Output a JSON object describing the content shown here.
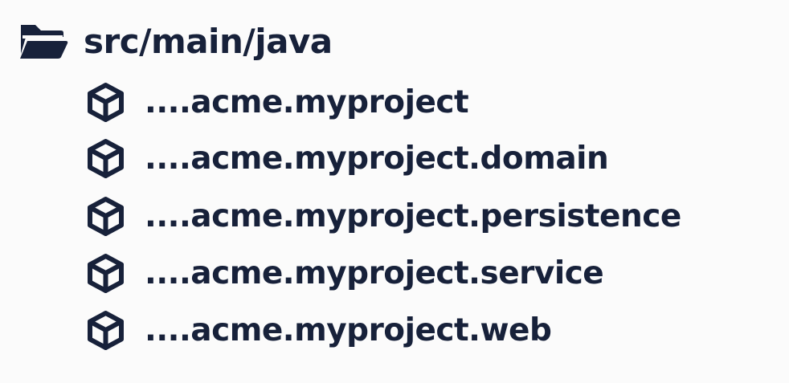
{
  "root": {
    "label": "src/main/java",
    "icon": "folder-open-icon"
  },
  "packages": [
    {
      "label": "....acme.myproject",
      "icon": "package-icon"
    },
    {
      "label": "....acme.myproject.domain",
      "icon": "package-icon"
    },
    {
      "label": "....acme.myproject.persistence",
      "icon": "package-icon"
    },
    {
      "label": "....acme.myproject.service",
      "icon": "package-icon"
    },
    {
      "label": "....acme.myproject.web",
      "icon": "package-icon"
    }
  ],
  "colors": {
    "background": "#fbfbfb",
    "foreground": "#17213a"
  }
}
